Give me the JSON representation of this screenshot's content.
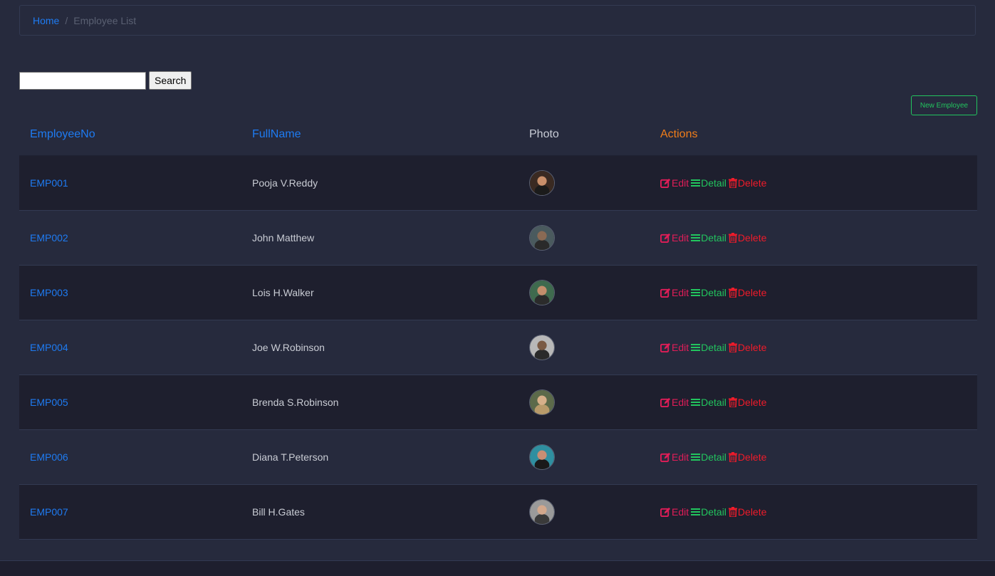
{
  "breadcrumb": {
    "home": "Home",
    "separator": "/",
    "current": "Employee List"
  },
  "search": {
    "value": "",
    "placeholder": "",
    "button_label": "Search"
  },
  "new_employee_label": "New Employee",
  "table": {
    "headers": {
      "employee_no": "EmployeeNo",
      "full_name": "FullName",
      "photo": "Photo",
      "actions": "Actions"
    },
    "actions": {
      "edit": "Edit",
      "detail": "Detail",
      "delete": "Delete"
    },
    "rows": [
      {
        "employee_no": "EMP001",
        "full_name": "Pooja V.Reddy"
      },
      {
        "employee_no": "EMP002",
        "full_name": "John Matthew"
      },
      {
        "employee_no": "EMP003",
        "full_name": "Lois H.Walker"
      },
      {
        "employee_no": "EMP004",
        "full_name": "Joe W.Robinson"
      },
      {
        "employee_no": "EMP005",
        "full_name": "Brenda S.Robinson"
      },
      {
        "employee_no": "EMP006",
        "full_name": "Diana T.Peterson"
      },
      {
        "employee_no": "EMP007",
        "full_name": "Bill H.Gates"
      }
    ]
  },
  "colors": {
    "background": "#262a3d",
    "row_dark": "#1e1f2e",
    "link_blue": "#1e7bf2",
    "actions_header": "#f07d1a",
    "edit": "#e11d58",
    "detail": "#22c55e",
    "delete": "#ef1b2a"
  },
  "icons": {
    "edit": "pencil-square-icon",
    "detail": "list-icon",
    "delete": "trash-icon"
  }
}
